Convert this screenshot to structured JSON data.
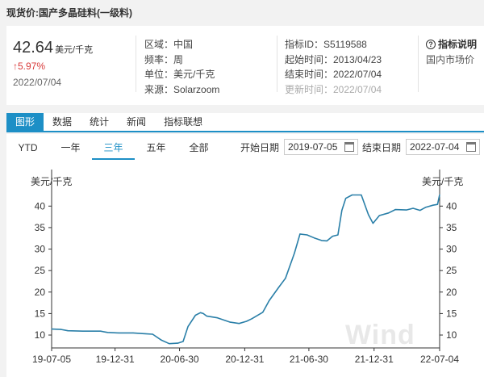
{
  "page_title": "现货价:国产多晶硅料(一级料)",
  "price": {
    "value": "42.64",
    "unit": "美元/千克",
    "change": "↑5.97%",
    "date": "2022/07/04"
  },
  "meta_left": {
    "region": "区域：中国",
    "frequency": "频率：周",
    "unit": "单位：美元/千克",
    "source": "来源：Solarzoom"
  },
  "meta_right": {
    "id": "指标ID：S5119588",
    "start": "起始时间：2013/04/23",
    "end": "结束时间：2022/07/04",
    "updated": "更新时间：2022/07/04"
  },
  "explain": {
    "title": "指标说明",
    "subtitle": "国内市场价"
  },
  "tabs": [
    "图形",
    "数据",
    "统计",
    "新闻",
    "指标联想"
  ],
  "range_tabs": [
    "YTD",
    "一年",
    "三年",
    "五年",
    "全部"
  ],
  "date_range": {
    "start_label": "开始日期",
    "start_value": "2019-07-05",
    "end_label": "结束日期",
    "end_value": "2022-07-04"
  },
  "watermark": "Wind",
  "colors": {
    "accent": "#1d8fc6",
    "line": "#2a7fa8",
    "up": "#d83a3a"
  },
  "chart_data": {
    "type": "line",
    "ylabel_left": "美元/千克",
    "ylabel_right": "美元/千克",
    "ylim": [
      7,
      44
    ],
    "yticks": [
      10,
      15,
      20,
      25,
      30,
      35,
      40
    ],
    "xlim": [
      "2019-07-05",
      "2022-07-04"
    ],
    "xticks": [
      "19-07-05",
      "19-12-31",
      "20-06-30",
      "20-12-31",
      "21-06-30",
      "21-12-31",
      "22-07-04"
    ],
    "xtick_dates": [
      "2019-07-05",
      "2019-12-31",
      "2020-06-30",
      "2020-12-31",
      "2021-06-30",
      "2021-12-31",
      "2022-07-04"
    ],
    "series": [
      {
        "values": [
          [
            "2019-07-05",
            11.4
          ],
          [
            "2019-08-01",
            11.3
          ],
          [
            "2019-08-20",
            11.0
          ],
          [
            "2019-10-01",
            10.9
          ],
          [
            "2019-11-20",
            10.9
          ],
          [
            "2019-12-10",
            10.6
          ],
          [
            "2020-01-10",
            10.5
          ],
          [
            "2020-02-20",
            10.5
          ],
          [
            "2020-03-25",
            10.3
          ],
          [
            "2020-04-15",
            10.2
          ],
          [
            "2020-05-10",
            8.8
          ],
          [
            "2020-06-01",
            8.0
          ],
          [
            "2020-06-25",
            8.1
          ],
          [
            "2020-07-10",
            8.5
          ],
          [
            "2020-07-24",
            12.0
          ],
          [
            "2020-08-14",
            14.6
          ],
          [
            "2020-08-28",
            15.2
          ],
          [
            "2020-09-05",
            15.0
          ],
          [
            "2020-09-15",
            14.4
          ],
          [
            "2020-10-15",
            14.0
          ],
          [
            "2020-11-20",
            13.0
          ],
          [
            "2020-12-15",
            12.7
          ],
          [
            "2021-01-05",
            13.2
          ],
          [
            "2021-01-20",
            13.8
          ],
          [
            "2021-02-20",
            15.3
          ],
          [
            "2021-03-10",
            18.0
          ],
          [
            "2021-04-05",
            21.0
          ],
          [
            "2021-04-25",
            23.2
          ],
          [
            "2021-05-20",
            29.0
          ],
          [
            "2021-06-05",
            33.5
          ],
          [
            "2021-06-25",
            33.3
          ],
          [
            "2021-07-15",
            32.6
          ],
          [
            "2021-08-05",
            32.0
          ],
          [
            "2021-08-20",
            31.9
          ],
          [
            "2021-09-05",
            33.0
          ],
          [
            "2021-09-20",
            33.3
          ],
          [
            "2021-10-01",
            39.0
          ],
          [
            "2021-10-12",
            41.8
          ],
          [
            "2021-10-30",
            42.6
          ],
          [
            "2021-11-25",
            42.6
          ],
          [
            "2021-12-15",
            38.0
          ],
          [
            "2021-12-28",
            36.0
          ],
          [
            "2022-01-15",
            37.8
          ],
          [
            "2022-02-10",
            38.4
          ],
          [
            "2022-03-01",
            39.2
          ],
          [
            "2022-04-01",
            39.1
          ],
          [
            "2022-04-20",
            39.5
          ],
          [
            "2022-05-10",
            39.0
          ],
          [
            "2022-05-25",
            39.7
          ],
          [
            "2022-06-15",
            40.2
          ],
          [
            "2022-06-28",
            40.4
          ],
          [
            "2022-07-04",
            42.64
          ]
        ]
      }
    ]
  }
}
